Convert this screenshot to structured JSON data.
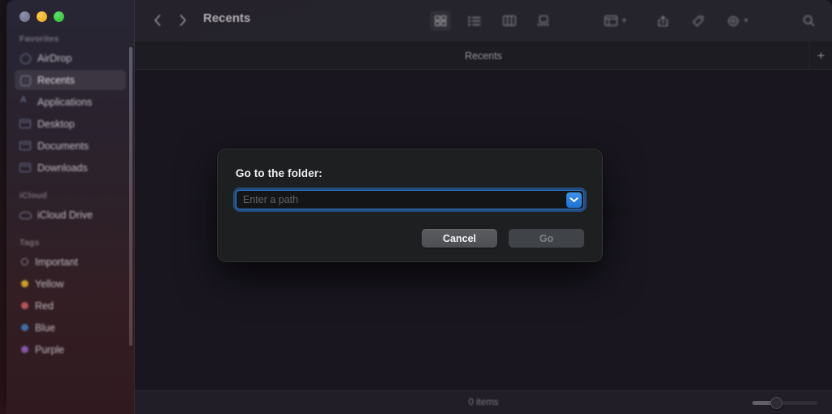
{
  "window": {
    "title": "Recents",
    "traffic_lights": [
      "close",
      "minimize",
      "maximize"
    ]
  },
  "toolbar": {
    "back_icon": "chevron-left-icon",
    "forward_icon": "chevron-right-icon",
    "title": "Recents",
    "view_modes": [
      {
        "name": "icon-view",
        "selected": true
      },
      {
        "name": "list-view",
        "selected": false
      },
      {
        "name": "column-view",
        "selected": false
      },
      {
        "name": "gallery-view",
        "selected": false
      }
    ],
    "actions": [
      {
        "name": "group-by-button",
        "has_chevron": true
      },
      {
        "name": "share-button",
        "has_chevron": false
      },
      {
        "name": "tag-button",
        "has_chevron": false
      },
      {
        "name": "action-menu-button",
        "has_chevron": true
      },
      {
        "name": "search-button",
        "has_chevron": false
      }
    ]
  },
  "tabbar": {
    "active_tab": "Recents",
    "new_tab_label": "+"
  },
  "sidebar": {
    "sections": [
      {
        "label": "Favorites",
        "items": [
          {
            "label": "AirDrop",
            "icon": "airdrop-icon",
            "selected": false
          },
          {
            "label": "Recents",
            "icon": "clock-icon",
            "selected": true
          },
          {
            "label": "Applications",
            "icon": "applications-icon",
            "selected": false
          },
          {
            "label": "Desktop",
            "icon": "folder-icon",
            "selected": false
          },
          {
            "label": "Documents",
            "icon": "folder-icon",
            "selected": false
          },
          {
            "label": "Downloads",
            "icon": "folder-icon",
            "selected": false
          }
        ]
      },
      {
        "label": "iCloud",
        "items": [
          {
            "label": "iCloud Drive",
            "icon": "cloud-icon",
            "selected": false
          }
        ]
      },
      {
        "label": "Tags",
        "items": [
          {
            "label": "Important",
            "icon": "tag-dot",
            "color": "hollow",
            "selected": false
          },
          {
            "label": "Yellow",
            "icon": "tag-dot",
            "color": "#c9a227",
            "selected": false
          },
          {
            "label": "Red",
            "icon": "tag-dot",
            "color": "#b4565c",
            "selected": false
          },
          {
            "label": "Blue",
            "icon": "tag-dot",
            "color": "#3d6fa8",
            "selected": false
          },
          {
            "label": "Purple",
            "icon": "tag-dot",
            "color": "#8657a8",
            "selected": false
          }
        ]
      }
    ]
  },
  "statusbar": {
    "item_count": "0 items",
    "zoom_slider_value": 28
  },
  "dialog": {
    "label": "Go to the folder:",
    "path_value": "",
    "path_placeholder": "Enter a path",
    "dropdown_icon": "chevron-down-icon",
    "cancel_label": "Cancel",
    "go_label": "Go",
    "go_enabled": false,
    "accent_color": "#2f7ed0"
  }
}
